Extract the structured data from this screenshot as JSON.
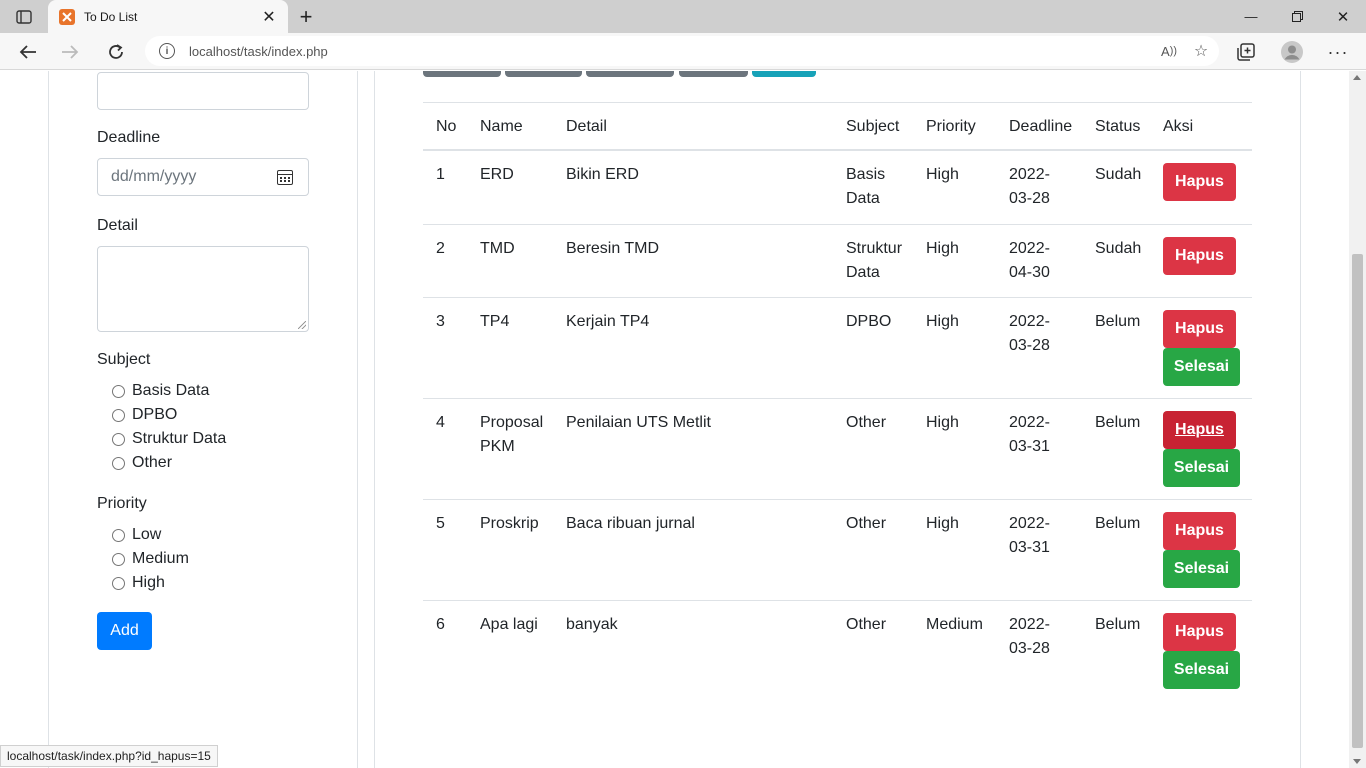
{
  "browser": {
    "tab_title": "To Do List",
    "url": "localhost/task/index.php",
    "status_url": "localhost/task/index.php?id_hapus=15"
  },
  "form": {
    "deadline_label": "Deadline",
    "deadline_placeholder": "dd/mm/yyyy",
    "detail_label": "Detail",
    "subject_label": "Subject",
    "subject_options": [
      "Basis Data",
      "DPBO",
      "Struktur Data",
      "Other"
    ],
    "priority_label": "Priority",
    "priority_options": [
      "Low",
      "Medium",
      "High"
    ],
    "add_label": "Add"
  },
  "table": {
    "headers": [
      "No",
      "Name",
      "Detail",
      "Subject",
      "Priority",
      "Deadline",
      "Status",
      "Aksi"
    ],
    "hapus_label": "Hapus",
    "selesai_label": "Selesai",
    "rows": [
      {
        "no": "1",
        "name": "ERD",
        "detail": "Bikin ERD",
        "subject": "Basis Data",
        "priority": "High",
        "deadline": "2022-03-28",
        "status": "Sudah"
      },
      {
        "no": "2",
        "name": "TMD",
        "detail": "Beresin TMD",
        "subject": "Struktur Data",
        "priority": "High",
        "deadline": "2022-04-30",
        "status": "Sudah"
      },
      {
        "no": "3",
        "name": "TP4",
        "detail": "Kerjain TP4",
        "subject": "DPBO",
        "priority": "High",
        "deadline": "2022-03-28",
        "status": "Belum"
      },
      {
        "no": "4",
        "name": "Proposal PKM",
        "detail": "Penilaian UTS Metlit",
        "subject": "Other",
        "priority": "High",
        "deadline": "2022-03-31",
        "status": "Belum"
      },
      {
        "no": "5",
        "name": "Proskrip",
        "detail": "Baca ribuan jurnal",
        "subject": "Other",
        "priority": "High",
        "deadline": "2022-03-31",
        "status": "Belum"
      },
      {
        "no": "6",
        "name": "Apa lagi",
        "detail": "banyak",
        "subject": "Other",
        "priority": "Medium",
        "deadline": "2022-03-28",
        "status": "Belum"
      }
    ]
  },
  "colors": {
    "danger": "#dc3545",
    "success": "#28a745",
    "primary": "#007bff",
    "secondary": "#6c757d",
    "info": "#17a2b8"
  }
}
